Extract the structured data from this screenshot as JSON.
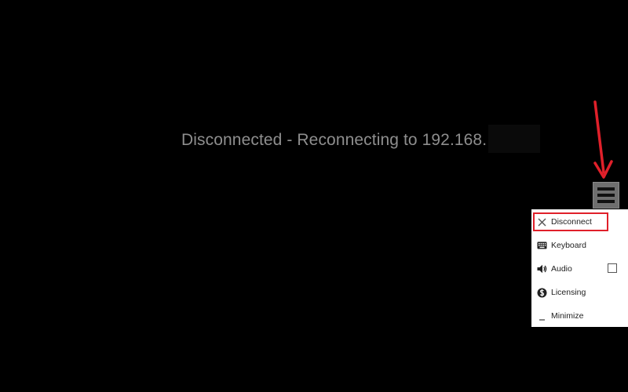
{
  "status": {
    "message": "Disconnected - Reconnecting to 192.168."
  },
  "menu": {
    "items": [
      {
        "label": "Disconnect",
        "icon": "close-icon"
      },
      {
        "label": "Keyboard",
        "icon": "keyboard-icon"
      },
      {
        "label": "Audio",
        "icon": "speaker-icon",
        "checkbox_checked": false
      },
      {
        "label": "Licensing",
        "icon": "dollar-circle-icon"
      },
      {
        "label": "Minimize",
        "icon": "minimize-icon"
      }
    ]
  },
  "colors": {
    "background": "#000000",
    "status_text": "#8e8e8e",
    "annotation_red": "#e0202a",
    "menu_toggle": "#6f6f6f",
    "menu_background": "#ffffff"
  }
}
